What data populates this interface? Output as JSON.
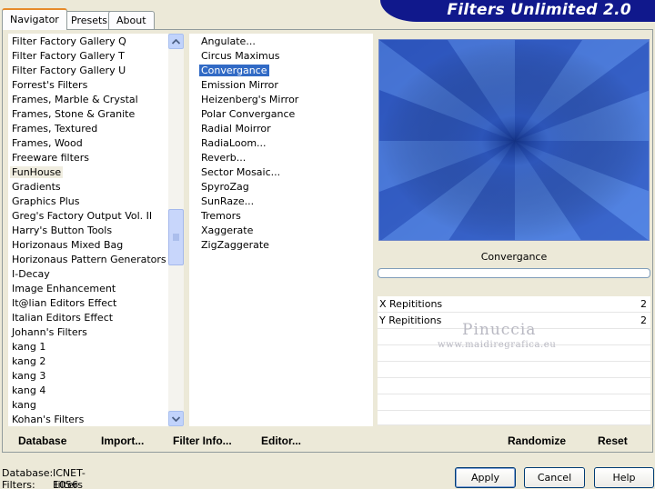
{
  "tabs": [
    "Navigator",
    "Presets",
    "About"
  ],
  "title": "Filters Unlimited 2.0",
  "categories": [
    "Filter Factory Gallery Q",
    "Filter Factory Gallery T",
    "Filter Factory Gallery U",
    "Forrest's Filters",
    "Frames, Marble & Crystal",
    "Frames, Stone & Granite",
    "Frames, Textured",
    "Frames, Wood",
    "Freeware filters",
    "FunHouse",
    "Gradients",
    "Graphics Plus",
    "Greg's Factory Output Vol. II",
    "Harry's Button Tools",
    "Horizonaus Mixed Bag",
    "Horizonaus Pattern Generators",
    "I-Decay",
    "Image Enhancement",
    "It@lian Editors Effect",
    "Italian Editors Effect",
    "Johann's Filters",
    "kang 1",
    "kang 2",
    "kang 3",
    "kang 4",
    "kang",
    "Kohan's Filters"
  ],
  "filters": [
    "Angulate...",
    "Circus Maximus",
    "Convergance",
    "Emission Mirror",
    "Heizenberg's Mirror",
    "Polar Convergance",
    "Radial Moirror",
    "RadiaLoom...",
    "Reverb...",
    "Sector Mosaic...",
    "SpyroZag",
    "SunRaze...",
    "Tremors",
    "Xaggerate",
    "ZigZaggerate"
  ],
  "selected_filter_label": "Convergance",
  "params": [
    {
      "name": "X Repititions",
      "value": "2"
    },
    {
      "name": "Y Repititions",
      "value": "2"
    }
  ],
  "watermark": {
    "name": "Pinuccia",
    "url": "www.maidiregrafica.eu"
  },
  "toolbar": {
    "database": "Database",
    "import": "Import...",
    "filter_info": "Filter Info...",
    "editor": "Editor...",
    "randomize": "Randomize",
    "reset": "Reset"
  },
  "status": {
    "database_label": "Database:",
    "database_value": "ICNET-Filters",
    "filters_label": "Filters:",
    "filters_value": "1056"
  },
  "buttons": {
    "apply": "Apply",
    "cancel": "Cancel",
    "help": "Help"
  },
  "colors": {
    "accent": "#316ac5",
    "banner": "#10188c",
    "preview": "#3a66c9",
    "tab_highlight": "#e68b2c"
  }
}
